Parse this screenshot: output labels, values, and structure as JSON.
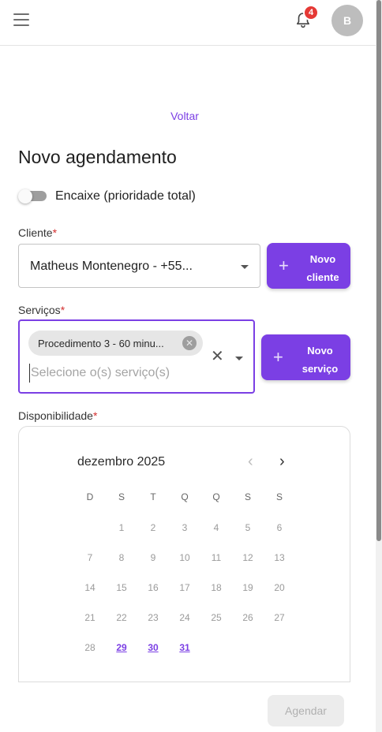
{
  "header": {
    "notification_count": "4",
    "avatar_initial": "B",
    "icons": [
      "menu-icon",
      "bell-icon"
    ]
  },
  "back_link": "Voltar",
  "page_title": "Novo agendamento",
  "encaixe": {
    "label": "Encaixe (prioridade total)",
    "enabled": false
  },
  "cliente": {
    "label": "Cliente",
    "required_mark": "*",
    "value": "Matheus Montenegro - +55...",
    "new_button": [
      "Novo",
      "cliente"
    ]
  },
  "servicos": {
    "label": "Serviços",
    "required_mark": "*",
    "chip": "Procedimento 3 - 60 minu...",
    "placeholder": "Selecione o(s) serviço(s)",
    "new_button": [
      "Novo",
      "serviço"
    ]
  },
  "disponibilidade": {
    "label": "Disponibilidade",
    "required_mark": "*"
  },
  "calendar": {
    "month_label": "dezembro 2025",
    "weekdays": [
      "D",
      "S",
      "T",
      "Q",
      "Q",
      "S",
      "S"
    ],
    "first_weekday_index": 1,
    "days": [
      "1",
      "2",
      "3",
      "4",
      "5",
      "6",
      "7",
      "8",
      "9",
      "10",
      "11",
      "12",
      "13",
      "14",
      "15",
      "16",
      "17",
      "18",
      "19",
      "20",
      "21",
      "22",
      "23",
      "24",
      "25",
      "26",
      "27",
      "28",
      "29",
      "30",
      "31"
    ],
    "available_days": [
      "29",
      "30",
      "31"
    ]
  },
  "colors": {
    "accent": "#7b3fe4",
    "badge": "#e53935",
    "required": "#d32f2f"
  },
  "submit_label": "Agendar"
}
